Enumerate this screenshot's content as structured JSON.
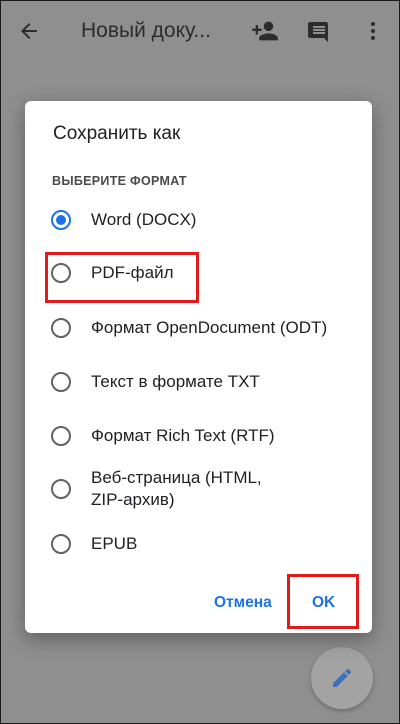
{
  "appbar": {
    "title": "Новый доку...",
    "icons": [
      "arrow-back-icon",
      "person-add-icon",
      "comment-icon",
      "more-vert-icon"
    ]
  },
  "dialog": {
    "title": "Сохранить как",
    "section_label": "ВЫБЕРИТЕ ФОРМАТ",
    "options": [
      {
        "label": "Word (DOCX)",
        "checked": true
      },
      {
        "label": "PDF-файл",
        "checked": false
      },
      {
        "label": "Формат OpenDocument (ODT)",
        "checked": false
      },
      {
        "label": "Текст в формате TXT",
        "checked": false
      },
      {
        "label": "Формат Rich Text (RTF)",
        "checked": false
      },
      {
        "label": "Веб-страница (HTML, ZIP-архив)",
        "checked": false
      },
      {
        "label": "EPUB",
        "checked": false
      }
    ],
    "cancel_label": "Отмена",
    "ok_label": "OK"
  },
  "fab": {
    "icon": "edit-pencil-icon"
  },
  "colors": {
    "accent": "#1a73e8",
    "highlight": "#e01b1b",
    "scrim": "#8f8f8f"
  }
}
